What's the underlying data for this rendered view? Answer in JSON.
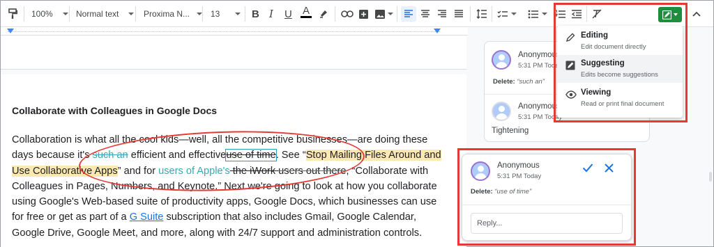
{
  "toolbar": {
    "zoom": "100%",
    "style": "Normal text",
    "font": "Proxima N...",
    "size": "13"
  },
  "document": {
    "heading": "Collaborate with Colleagues in Google Docs",
    "p1": "Collaboration is what all the cool kids—well, all the competitive businesses—are doing these",
    "p2a": "days because it's ",
    "p2_deleted": "such an",
    "p2b": " efficient and effective",
    "p2_deleted2": "use of time",
    "p2c": ". See “",
    "p2_link_hl": "Stop Mailing Files Around and",
    "p3_link_hl": "Use Collaborative Apps",
    "p3a": "” and for ",
    "p3_inserted": "users of Apple's",
    "p3_deleted": " the iWork ",
    "p3_deleted2": "users out there",
    "p3b": ", “Collaborate with",
    "p4": "Colleagues in Pages, Numbers, and Keynote.” Next we're going to look at how you collaborate",
    "p5": "using Google's Web-based suite of productivity apps, Google Docs, which businesses can use",
    "p6a": "for free or get as part of a ",
    "p6_link": "G Suite",
    "p6b": " subscription that also includes Gmail, Google Calendar,",
    "p7": "Google Drive, Google Meet, and more, along with 24/7 support and administration controls."
  },
  "comments": [
    {
      "name": "Anonymous",
      "time": "5:31 PM Today",
      "delete_label": "Delete:",
      "delete_text": "“such an”"
    },
    {
      "name": "Anonymous",
      "time": "5:31 PM Today",
      "note": "Tightening"
    },
    {
      "name": "Anonymous",
      "time": "5:31 PM Today",
      "delete_label": "Delete:",
      "delete_text": "“use of time”",
      "reply_placeholder": "Reply..."
    }
  ],
  "mode_menu": {
    "items": [
      {
        "title": "Editing",
        "desc": "Edit document directly",
        "icon": "pencil-icon"
      },
      {
        "title": "Suggesting",
        "desc": "Edits become suggestions",
        "icon": "suggest-edit-icon",
        "selected": true
      },
      {
        "title": "Viewing",
        "desc": "Read or print final document",
        "icon": "eye-icon"
      }
    ]
  },
  "colors": {
    "accent": "#1a73e8",
    "suggest_green": "#1e8e3e",
    "annotation_red": "#e53935",
    "suggestion_teal": "#3aa8b0",
    "highlight": "#fce8b2"
  }
}
